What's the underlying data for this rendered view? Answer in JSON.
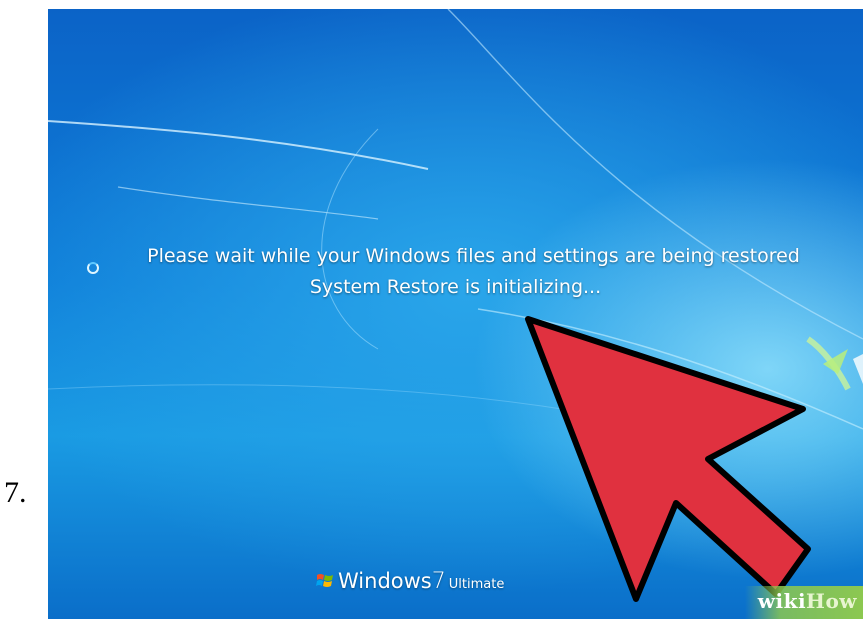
{
  "step_number": "7.",
  "screen": {
    "status_line1": "Please wait while your Windows files and settings are being restored",
    "status_line2": "System Restore is initializing...",
    "brand": {
      "windows": "Windows",
      "version": "7",
      "edition": "Ultimate"
    },
    "spinner_icon": "loading-spinner-icon",
    "flag_icon": "windows-flag-icon"
  },
  "watermark": {
    "wiki": "wiki",
    "how": "How"
  },
  "colors": {
    "arrow_fill": "#e0313f",
    "arrow_outline": "#000000",
    "desktop_blue": "#0f7fd9"
  }
}
